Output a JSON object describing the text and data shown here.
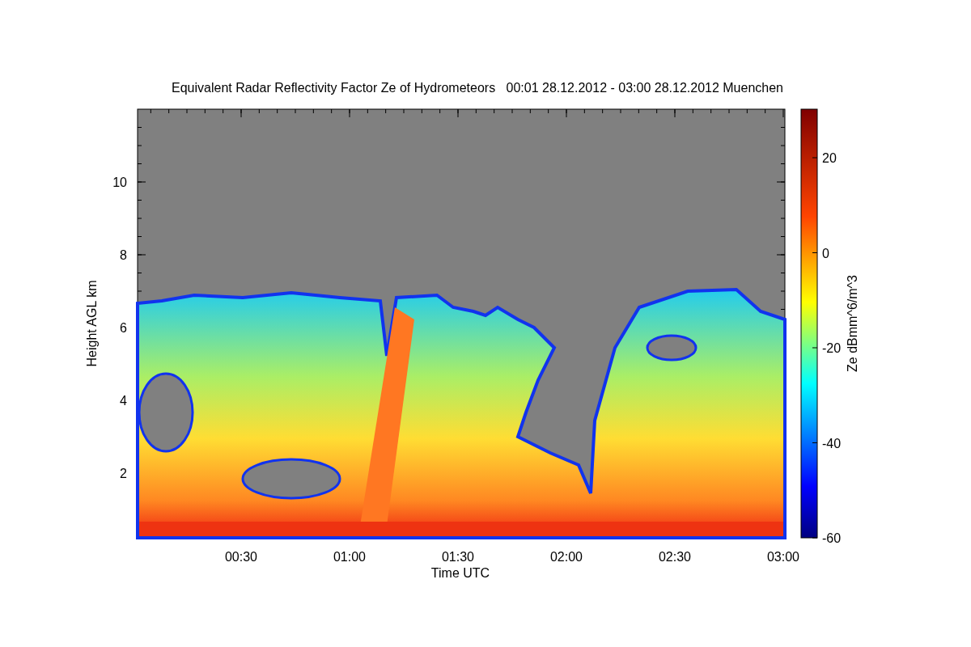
{
  "chart": {
    "title": "Equivalent Radar Reflectivity Factor Ze of Hydrometeors   00:01 28.12.2012 - 03:00 28.12.2012 Muenchen",
    "xlabel": "Time UTC",
    "ylabel": "Height AGL km",
    "xtick_labels": [
      "00:30",
      "01:00",
      "01:30",
      "02:00",
      "02:30",
      "03:00"
    ],
    "ytick_labels": [
      "10",
      "8",
      "6",
      "4",
      "2"
    ],
    "colorbar": {
      "label": "Ze dBmm^6/m^3",
      "tick_labels": [
        "20",
        "0",
        "-20",
        "-40",
        "-60"
      ]
    }
  }
}
